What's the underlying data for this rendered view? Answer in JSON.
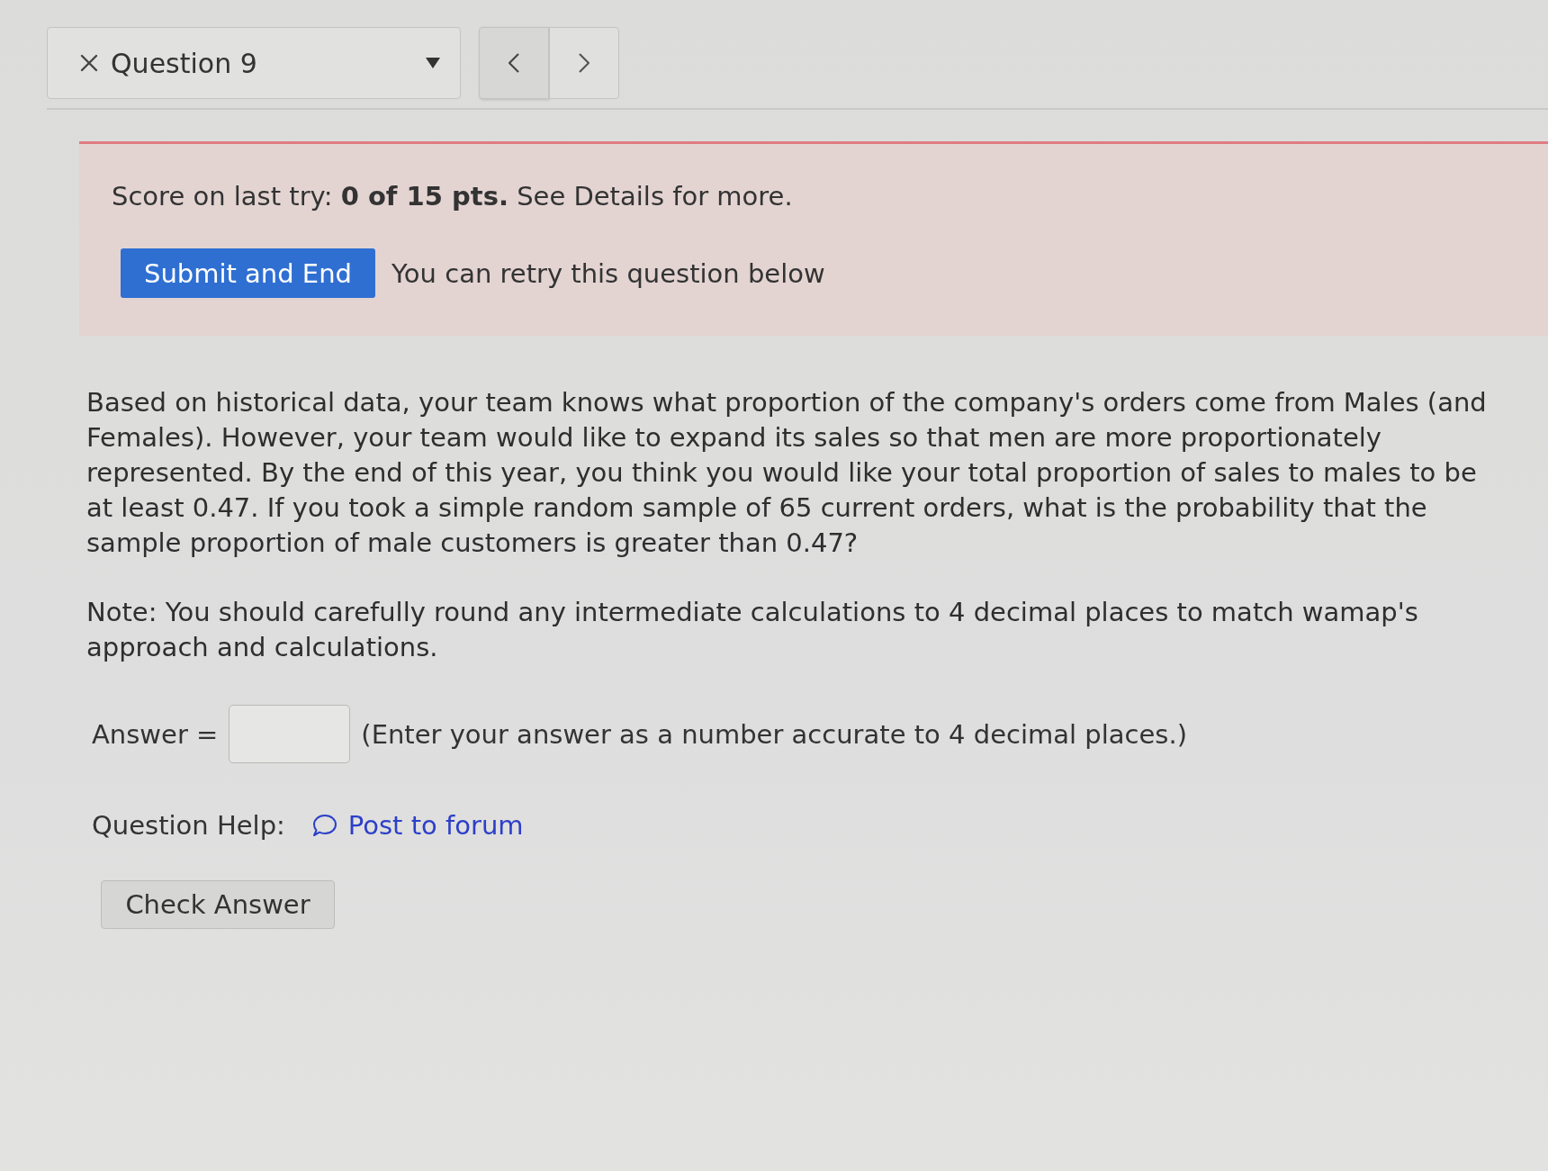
{
  "question_selector": {
    "label": "Question 9"
  },
  "score_panel": {
    "score_text": "Score on last try: **0 of 15 pts.** See Details for more.",
    "submit_button": "Submit and End",
    "retry_note": "You can retry this question below"
  },
  "question": {
    "paragraphs": [
      "Based on historical data, your team knows what proportion of the company's orders come from Males (and Females). However, your team would like to expand its sales so that men are more proportionately represented. By the end of this year, you think you would like your total proportion of sales to males to be at least 0.47. If you took a simple random sample of 65 current orders, what is the probability that the sample proportion of male customers is greater than 0.47?",
      "Note: You should carefully round any intermediate calculations to 4 decimal places to match wamap's approach and calculations."
    ],
    "answer": {
      "label": "Answer =",
      "hint": "(Enter your answer as a number accurate to 4 decimal places.)"
    },
    "help": {
      "label": "Question Help:",
      "link": "Post to forum"
    },
    "check_button": "Check Answer"
  }
}
